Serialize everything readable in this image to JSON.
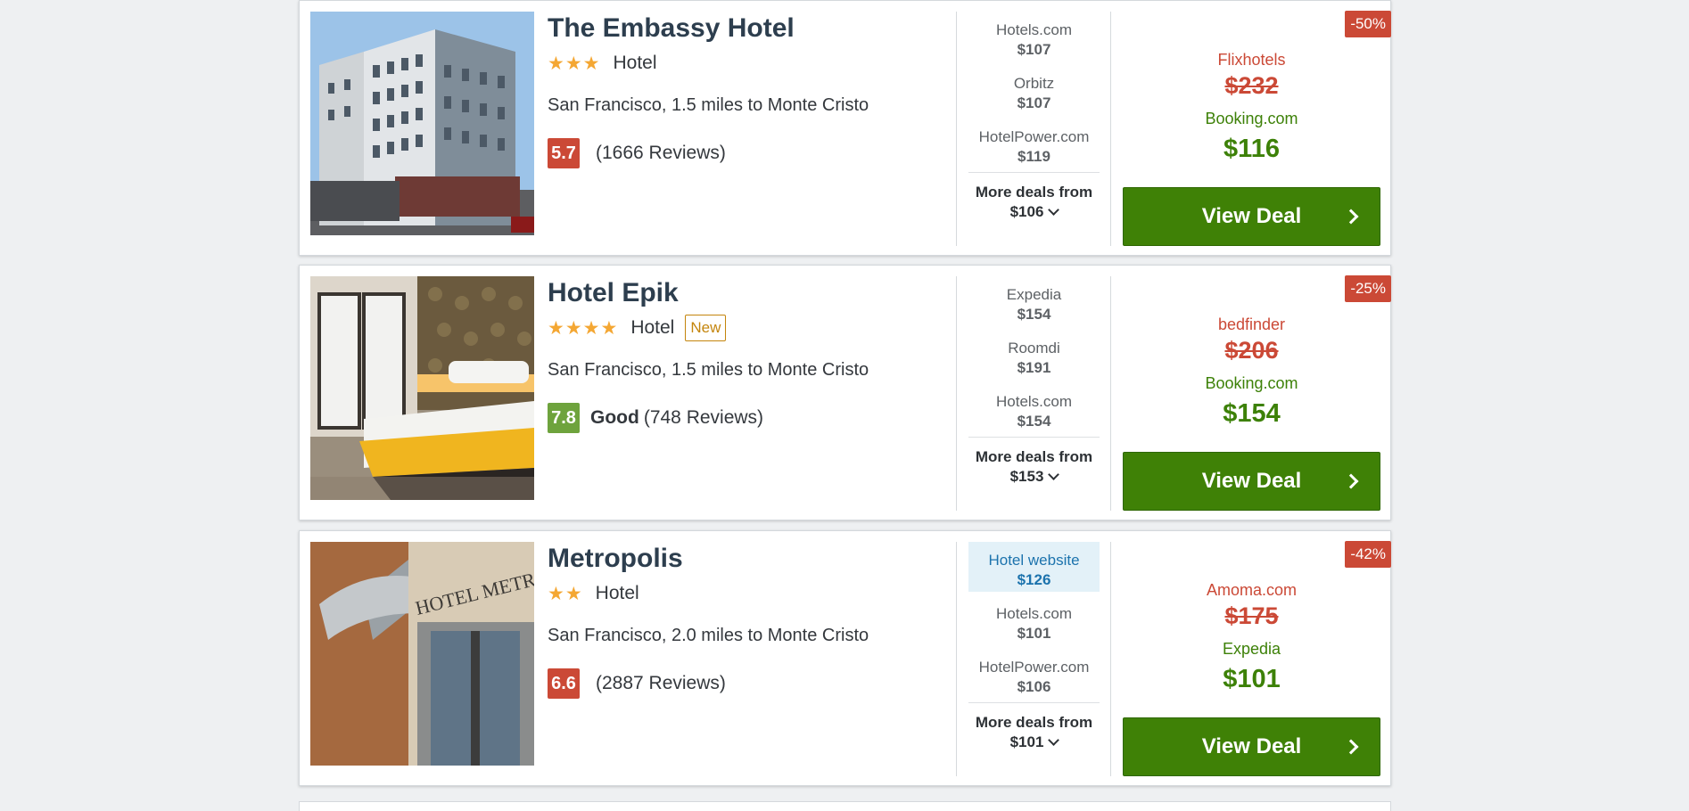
{
  "colors": {
    "price_red": "#cb4936",
    "price_green": "#3d8108",
    "button_green": "#3f8106",
    "star": "#f4a733",
    "highlight_bg": "#e3f1f8"
  },
  "hotels": [
    {
      "name": "The Embassy Hotel",
      "stars": "★★★",
      "type": "Hotel",
      "new_badge": "",
      "location": "San Francisco, 1.5 miles to Monte Cristo",
      "score": "5.7",
      "score_label": "",
      "reviews": "(1666 Reviews)",
      "offers": [
        {
          "provider": "Hotels.com",
          "price": "$107"
        },
        {
          "provider": "Orbitz",
          "price": "$107"
        },
        {
          "provider": "HotelPower.com",
          "price": "$119"
        }
      ],
      "more_label": "More deals from",
      "more_price": "$106",
      "discount": "-50%",
      "old_provider": "Flixhotels",
      "old_price": "$232",
      "deal_provider": "Booking.com",
      "deal_price": "$116",
      "button": "View Deal"
    },
    {
      "name": "Hotel Epik",
      "stars": "★★★★",
      "type": "Hotel",
      "new_badge": "New",
      "location": "San Francisco, 1.5 miles to Monte Cristo",
      "score": "7.8",
      "score_label": "Good",
      "reviews": "(748 Reviews)",
      "offers": [
        {
          "provider": "Expedia",
          "price": "$154"
        },
        {
          "provider": "Roomdi",
          "price": "$191"
        },
        {
          "provider": "Hotels.com",
          "price": "$154"
        }
      ],
      "more_label": "More deals from",
      "more_price": "$153",
      "discount": "-25%",
      "old_provider": "bedfinder",
      "old_price": "$206",
      "deal_provider": "Booking.com",
      "deal_price": "$154",
      "button": "View Deal"
    },
    {
      "name": "Metropolis",
      "stars": "★★",
      "type": "Hotel",
      "new_badge": "",
      "location": "San Francisco, 2.0 miles to Monte Cristo",
      "score": "6.6",
      "score_label": "",
      "reviews": "(2887 Reviews)",
      "offers": [
        {
          "provider": "Hotel website",
          "price": "$126"
        },
        {
          "provider": "Hotels.com",
          "price": "$101"
        },
        {
          "provider": "HotelPower.com",
          "price": "$106"
        }
      ],
      "more_label": "More deals from",
      "more_price": "$101",
      "discount": "-42%",
      "old_provider": "Amoma.com",
      "old_price": "$175",
      "deal_provider": "Expedia",
      "deal_price": "$101",
      "button": "View Deal"
    }
  ]
}
